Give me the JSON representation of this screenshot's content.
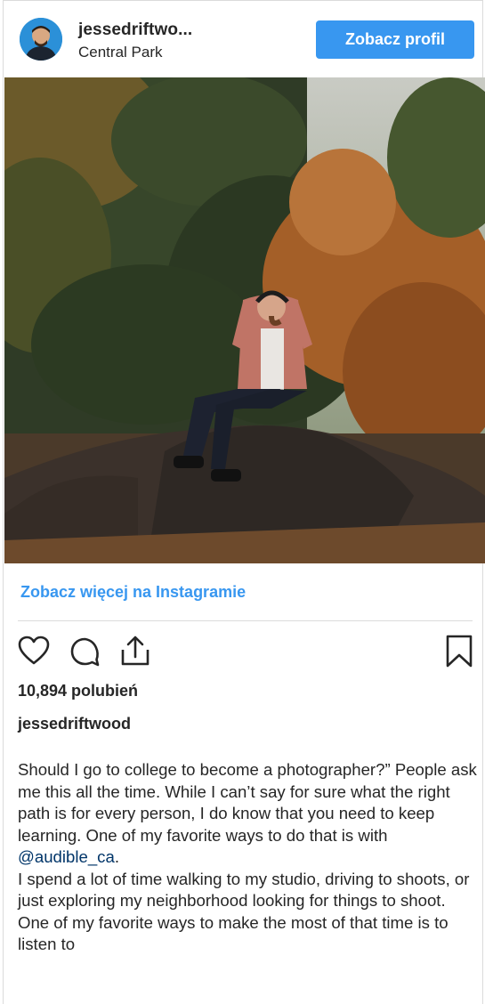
{
  "header": {
    "username": "jessedriftwo...",
    "location": "Central Park",
    "profile_button": "Zobacz profil"
  },
  "post": {
    "more_link": "Zobacz więcej na Instagramie",
    "likes": "10,894 polubień",
    "caption_user": "jessedriftwood",
    "caption_part1": "Should I go to college to become a photographer?” People ask me this all the time. While I can’t say for sure what the right path is for every person, I do know that you need to keep learning. One of my favorite ways to do that is with ",
    "mention": "@audible_ca",
    "caption_part2": ".\nI spend a lot of time walking to my studio, driving to shoots, or just exploring my neighborhood looking for things to shoot. One of my favorite ways to make the most of that time is to listen to"
  },
  "icons": {
    "like": "heart-icon",
    "comment": "comment-icon",
    "share": "share-icon",
    "save": "bookmark-icon"
  },
  "colors": {
    "accent": "#3897f0",
    "mention": "#003569",
    "text": "#262626",
    "border": "#dbdbdb"
  }
}
